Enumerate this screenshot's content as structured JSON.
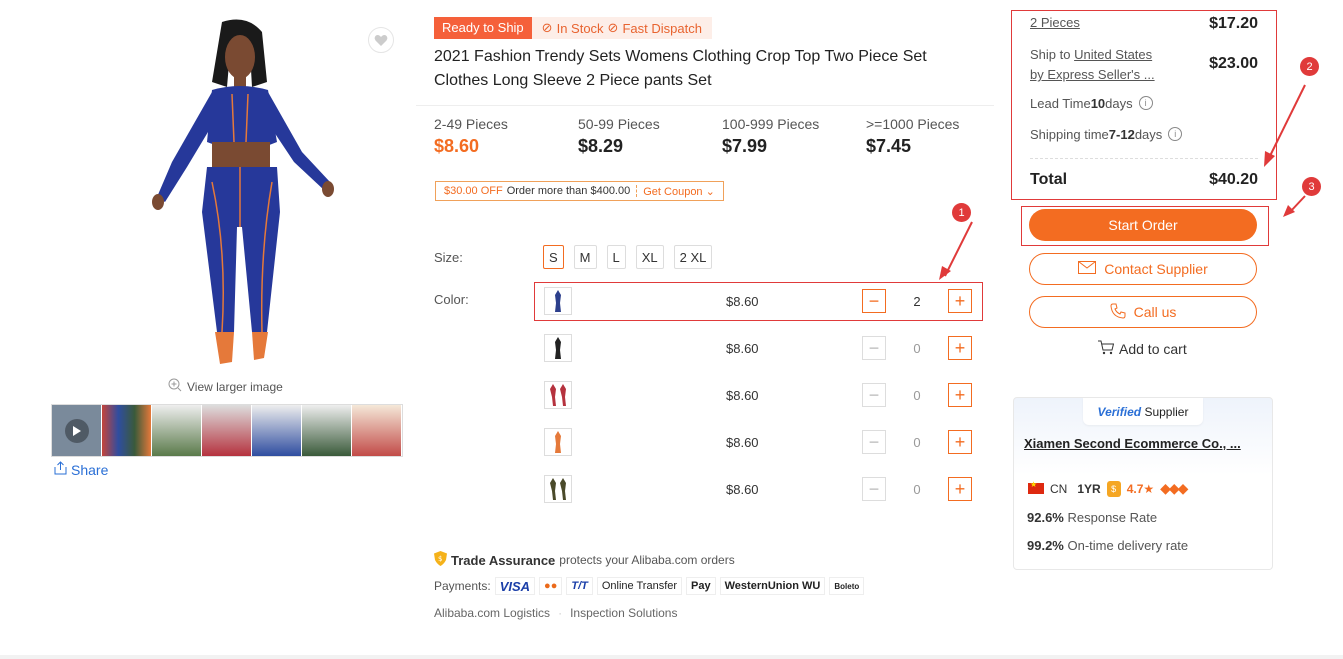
{
  "gallery": {
    "view_larger": "View larger image",
    "share": "Share",
    "thumb_colors": [
      "#7a8a9b",
      "#c5443a",
      "#5a7a4a",
      "#b5323e",
      "#2f4da0",
      "#3a5a3a",
      "#c24b48"
    ]
  },
  "product": {
    "tag_ready": "Ready to Ship",
    "tag_stock": "In Stock",
    "tag_dispatch": "Fast Dispatch",
    "title": "2021 Fashion Trendy Sets Womens Clothing Crop Top Two Piece Set Clothes Long Sleeve 2 Piece pants Set"
  },
  "tiers": [
    {
      "range": "2-49 Pieces",
      "price": "$8.60"
    },
    {
      "range": "50-99 Pieces",
      "price": "$8.29"
    },
    {
      "range": "100-999 Pieces",
      "price": "$7.99"
    },
    {
      "range": ">=1000 Pieces",
      "price": "$7.45"
    }
  ],
  "coupon": {
    "off": "$30.00 OFF",
    "condition": "Order more than $400.00",
    "get": "Get Coupon"
  },
  "size": {
    "label": "Size:",
    "options": [
      "S",
      "M",
      "L",
      "XL",
      "2 XL"
    ],
    "selected": "S"
  },
  "colors": {
    "label": "Color:",
    "rows": [
      {
        "price": "$8.60",
        "qty": "2",
        "swatch": "#2c3f8c"
      },
      {
        "price": "$8.60",
        "qty": "0",
        "swatch": "#222222"
      },
      {
        "price": "$8.60",
        "qty": "0",
        "swatch": "#b5323e"
      },
      {
        "price": "$8.60",
        "qty": "0",
        "swatch": "#e5793a"
      },
      {
        "price": "$8.60",
        "qty": "0",
        "swatch": "#4a4a2a"
      }
    ]
  },
  "trade": {
    "title": "Trade Assurance",
    "desc": "protects your Alibaba.com orders",
    "payments_label": "Payments:",
    "payments": [
      "VISA",
      "●●",
      "T/T",
      "Online Transfer",
      "Pay",
      "WesternUnion WU",
      "Boleto"
    ],
    "logistics": "Alibaba.com Logistics",
    "inspection": "Inspection Solutions"
  },
  "order": {
    "pieces": "2 Pieces",
    "pieces_price": "$17.20",
    "ship_to_prefix": "Ship to ",
    "ship_to": "United States",
    "ship_by": "by Express Seller's ...",
    "ship_price": "$23.00",
    "lead_prefix": "Lead Time ",
    "lead_value": "10",
    "lead_suffix": " days",
    "shipping_prefix": "Shipping time ",
    "shipping_value": "7-12",
    "shipping_suffix": " days",
    "total_label": "Total",
    "total": "$40.20",
    "start_order": "Start Order",
    "contact": "Contact Supplier",
    "call": "Call us",
    "cart": "Add to cart"
  },
  "supplier": {
    "verified_v": "Verified",
    "verified_s": "Supplier",
    "name": "Xiamen Second Ecommerce Co., ...",
    "country": "CN",
    "years": "1YR",
    "rating": "4.7★",
    "response_value": "92.6%",
    "response_label": " Response Rate",
    "ontime_value": "99.2%",
    "ontime_label": " On-time delivery rate"
  },
  "annotations": {
    "b1": "1",
    "b2": "2",
    "b3": "3"
  },
  "accent": "#f36c21",
  "highlight": "#e03a3a"
}
